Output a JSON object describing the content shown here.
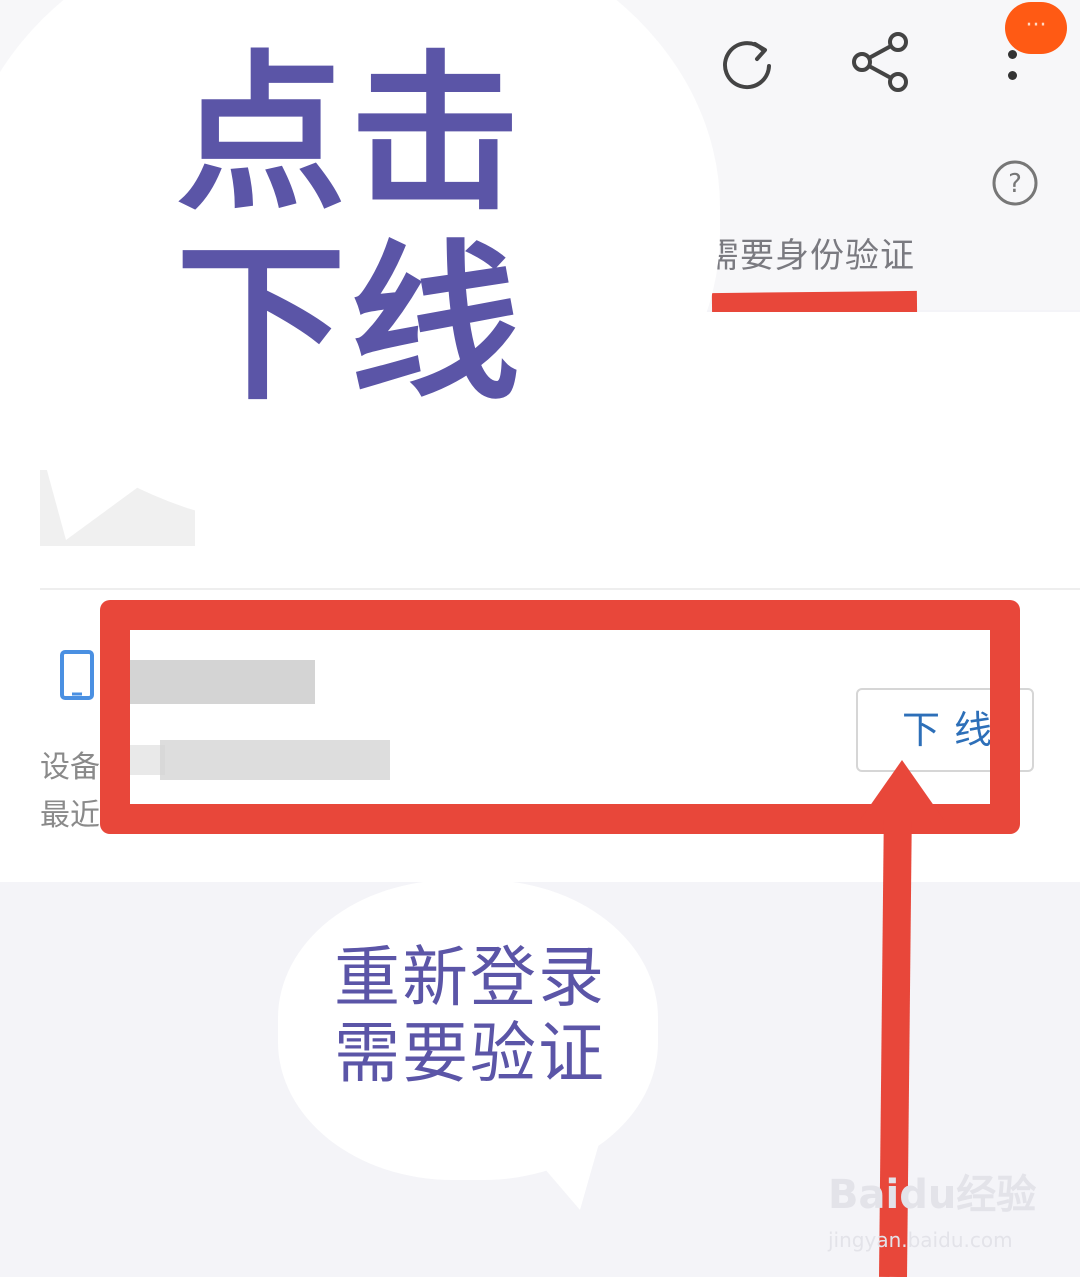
{
  "toolbar": {
    "refresh_icon": "refresh-icon",
    "share_icon": "share-icon",
    "more_icon": "more-vertical-icon",
    "badge_text": "···"
  },
  "help": {
    "icon": "help-circle-icon",
    "symbol": "?"
  },
  "tab": {
    "label": "需要身份验证"
  },
  "device": {
    "icon": "tablet-icon",
    "label_line1": "设备",
    "label_line2": "最近"
  },
  "logout_button": {
    "label": "下线"
  },
  "annotations": {
    "primary": "点击下线",
    "secondary": "重新登录需要验证"
  },
  "watermark": {
    "logo": "Baidu经验",
    "url": "jingyan.baidu.com"
  },
  "colors": {
    "accent_red": "#e8473a",
    "annotation_purple": "#5b55a7",
    "badge_orange": "#ff5a14",
    "link_blue": "#2d6fb8"
  }
}
